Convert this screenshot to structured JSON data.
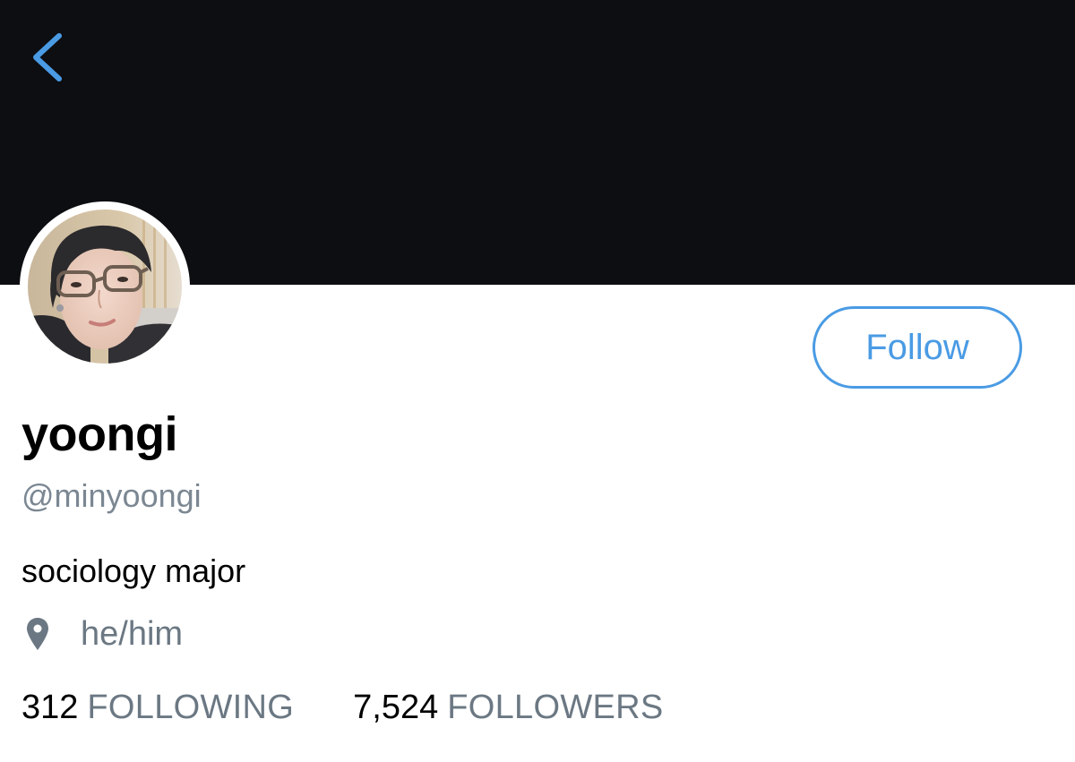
{
  "profile": {
    "display_name": "yoongi",
    "handle": "@minyoongi",
    "bio": "sociology major",
    "location": "he/him",
    "follow_label": "Follow"
  },
  "stats": {
    "following_count": "312",
    "following_label": "FOLLOWING",
    "followers_count": "7,524",
    "followers_label": "FOLLOWERS"
  },
  "icons": {
    "back": "chevron-left-icon",
    "location": "location-pin-icon"
  },
  "colors": {
    "accent": "#4a9be4",
    "banner": "#0d0e12",
    "secondary_text": "#6b7883",
    "primary_text": "#000000"
  }
}
